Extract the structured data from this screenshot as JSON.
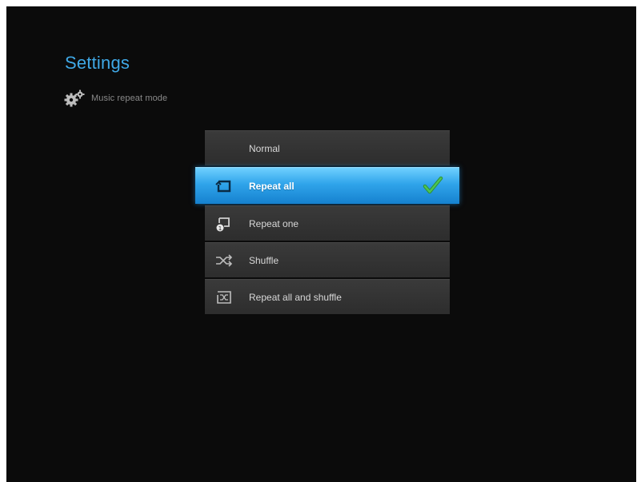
{
  "header": {
    "title": "Settings",
    "subtitle": "Music repeat mode",
    "subtitle_icon": "gear-icon"
  },
  "menu": {
    "selected_index": 1,
    "items": [
      {
        "label": "Normal",
        "icon": "none",
        "selected": false
      },
      {
        "label": "Repeat all",
        "icon": "repeat-all-icon",
        "selected": true
      },
      {
        "label": "Repeat one",
        "icon": "repeat-one-icon",
        "selected": false
      },
      {
        "label": "Shuffle",
        "icon": "shuffle-icon",
        "selected": false
      },
      {
        "label": "Repeat all and shuffle",
        "icon": "repeat-shuffle-icon",
        "selected": false
      }
    ]
  },
  "colors": {
    "background": "#0b0b0b",
    "title": "#3fa8e6",
    "selected": "#2fa4ea",
    "check": "#3cb043",
    "item": "#333333"
  }
}
